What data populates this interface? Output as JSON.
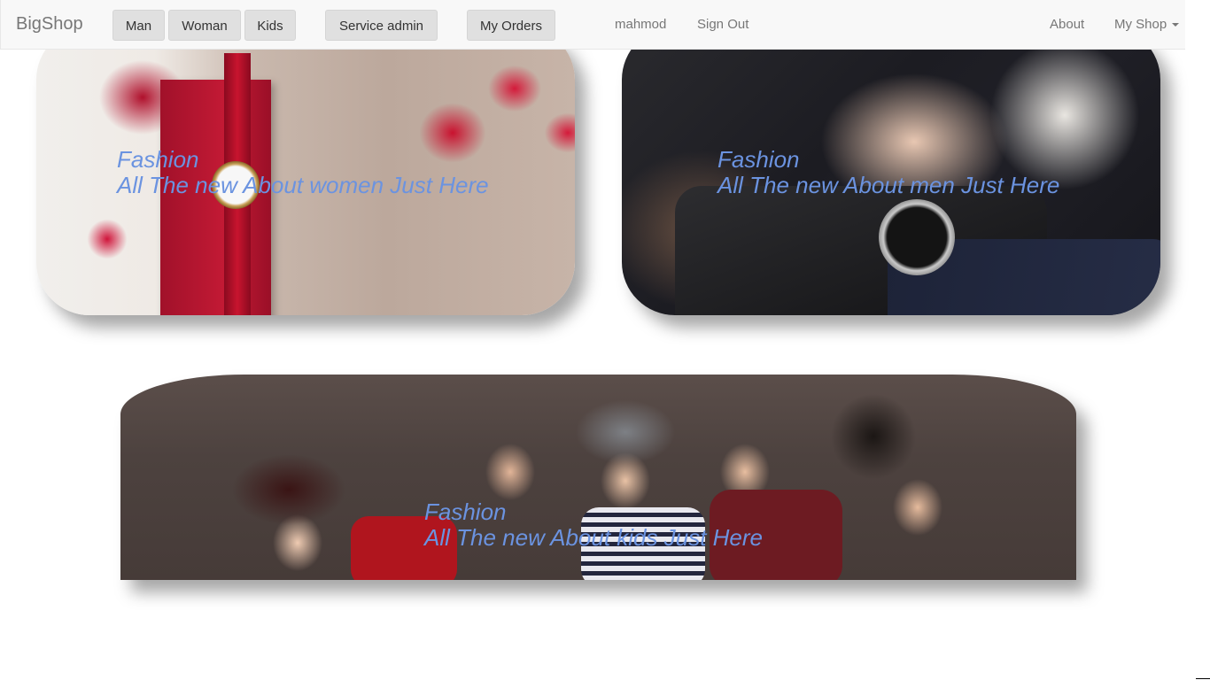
{
  "navbar": {
    "brand": "BigShop",
    "buttons": {
      "man": "Man",
      "woman": "Woman",
      "kids": "Kids",
      "service_admin": "Service admin",
      "my_orders": "My Orders"
    },
    "user": "mahmod",
    "sign_out": "Sign Out",
    "about": "About",
    "my_shop": "My Shop"
  },
  "cards": {
    "women": {
      "title": "Fashion",
      "subtitle": "All The new About women Just Here"
    },
    "men": {
      "title": "Fashion",
      "subtitle": "All The new About men Just Here"
    },
    "kids": {
      "title": "Fashion",
      "subtitle": "All The new About kids Just Here"
    }
  },
  "colors": {
    "caption": "#6b93e0",
    "navbar_bg": "#f8f8f8",
    "button_bg": "#e0e0e0"
  }
}
